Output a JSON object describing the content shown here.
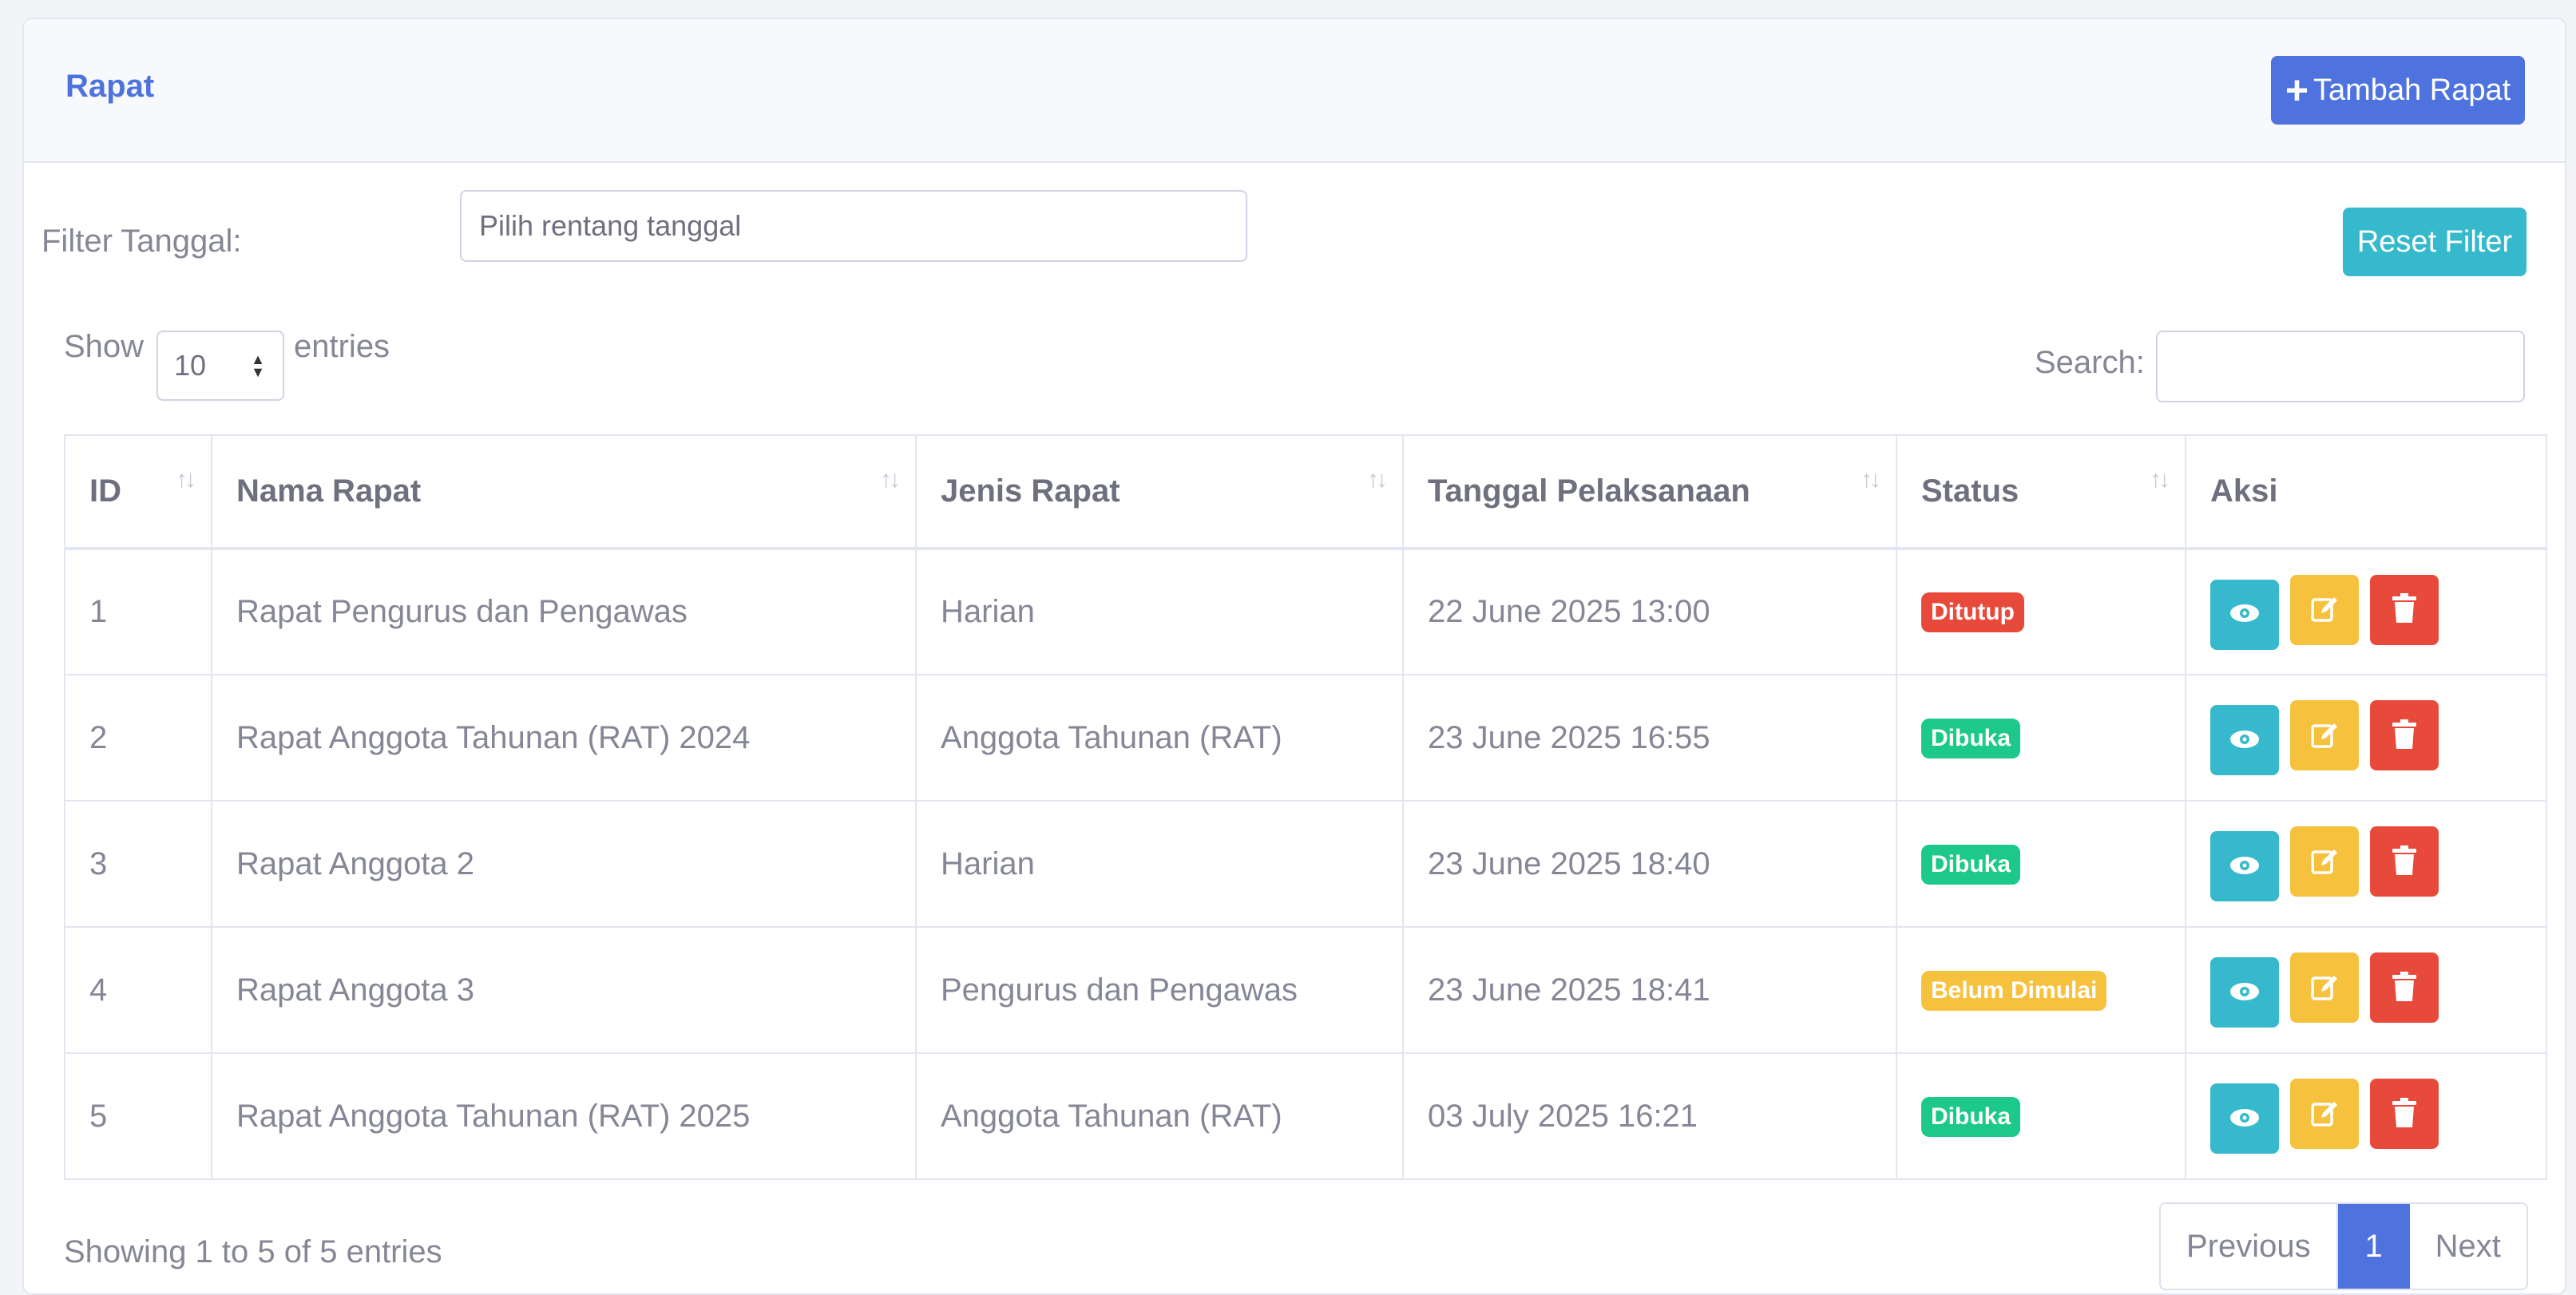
{
  "header": {
    "title": "Rapat",
    "add_button_label": "Tambah Rapat"
  },
  "filter": {
    "label": "Filter Tanggal:",
    "placeholder": "Pilih rentang tanggal",
    "reset_label": "Reset Filter"
  },
  "length": {
    "show": "Show",
    "value": "10",
    "entries": "entries"
  },
  "search": {
    "label": "Search:",
    "value": ""
  },
  "table": {
    "columns": [
      "ID",
      "Nama Rapat",
      "Jenis Rapat",
      "Tanggal Pelaksanaan",
      "Status",
      "Aksi"
    ],
    "rows": [
      {
        "id": "1",
        "nama": "Rapat Pengurus dan Pengawas",
        "jenis": "Harian",
        "tanggal": "22 June 2025 13:00",
        "status": "Ditutup",
        "status_color": "#e74a3b"
      },
      {
        "id": "2",
        "nama": "Rapat Anggota Tahunan (RAT) 2024",
        "jenis": "Anggota Tahunan (RAT)",
        "tanggal": "23 June 2025 16:55",
        "status": "Dibuka",
        "status_color": "#1cc88a"
      },
      {
        "id": "3",
        "nama": "Rapat Anggota 2",
        "jenis": "Harian",
        "tanggal": "23 June 2025 18:40",
        "status": "Dibuka",
        "status_color": "#1cc88a"
      },
      {
        "id": "4",
        "nama": "Rapat Anggota 3",
        "jenis": "Pengurus dan Pengawas",
        "tanggal": "23 June 2025 18:41",
        "status": "Belum Dimulai",
        "status_color": "#f6c23e"
      },
      {
        "id": "5",
        "nama": "Rapat Anggota Tahunan (RAT) 2025",
        "jenis": "Anggota Tahunan (RAT)",
        "tanggal": "03 July 2025 16:21",
        "status": "Dibuka",
        "status_color": "#1cc88a"
      }
    ]
  },
  "footer": {
    "info": "Showing 1 to 5 of 5 entries",
    "prev": "Previous",
    "page": "1",
    "next": "Next"
  },
  "colors": {
    "primary": "#4e73df",
    "info": "#36b9cc",
    "warning": "#f6c23e",
    "danger": "#e74a3b",
    "success": "#1cc88a"
  }
}
